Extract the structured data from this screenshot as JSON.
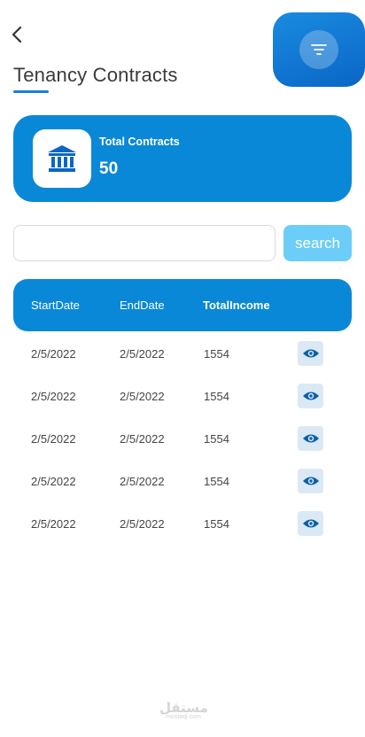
{
  "header": {
    "title": "Tenancy Contracts"
  },
  "summary": {
    "label": "Total Contracts",
    "value": "50"
  },
  "search": {
    "value": "",
    "placeholder": "",
    "button_label": "search"
  },
  "table": {
    "headers": [
      "StartDate",
      "EndDate",
      "TotalIncome"
    ],
    "rows": [
      {
        "start_date": "2/5/2022",
        "end_date": "2/5/2022",
        "total_income": "1554"
      },
      {
        "start_date": "2/5/2022",
        "end_date": "2/5/2022",
        "total_income": "1554"
      },
      {
        "start_date": "2/5/2022",
        "end_date": "2/5/2022",
        "total_income": "1554"
      },
      {
        "start_date": "2/5/2022",
        "end_date": "2/5/2022",
        "total_income": "1554"
      },
      {
        "start_date": "2/5/2022",
        "end_date": "2/5/2022",
        "total_income": "1554"
      }
    ]
  },
  "watermark": {
    "arabic": "مستقل",
    "latin": "mostaql.com"
  },
  "icons": {
    "back": "chevron-left-icon",
    "filter": "filter-icon",
    "summary": "bank-building-icon",
    "view": "eye-icon"
  },
  "colors": {
    "primary": "#0a88d8",
    "accent_light": "#6ccdf8",
    "view_button_bg": "#dbe9f5",
    "eye_icon": "#0a5fa8"
  }
}
